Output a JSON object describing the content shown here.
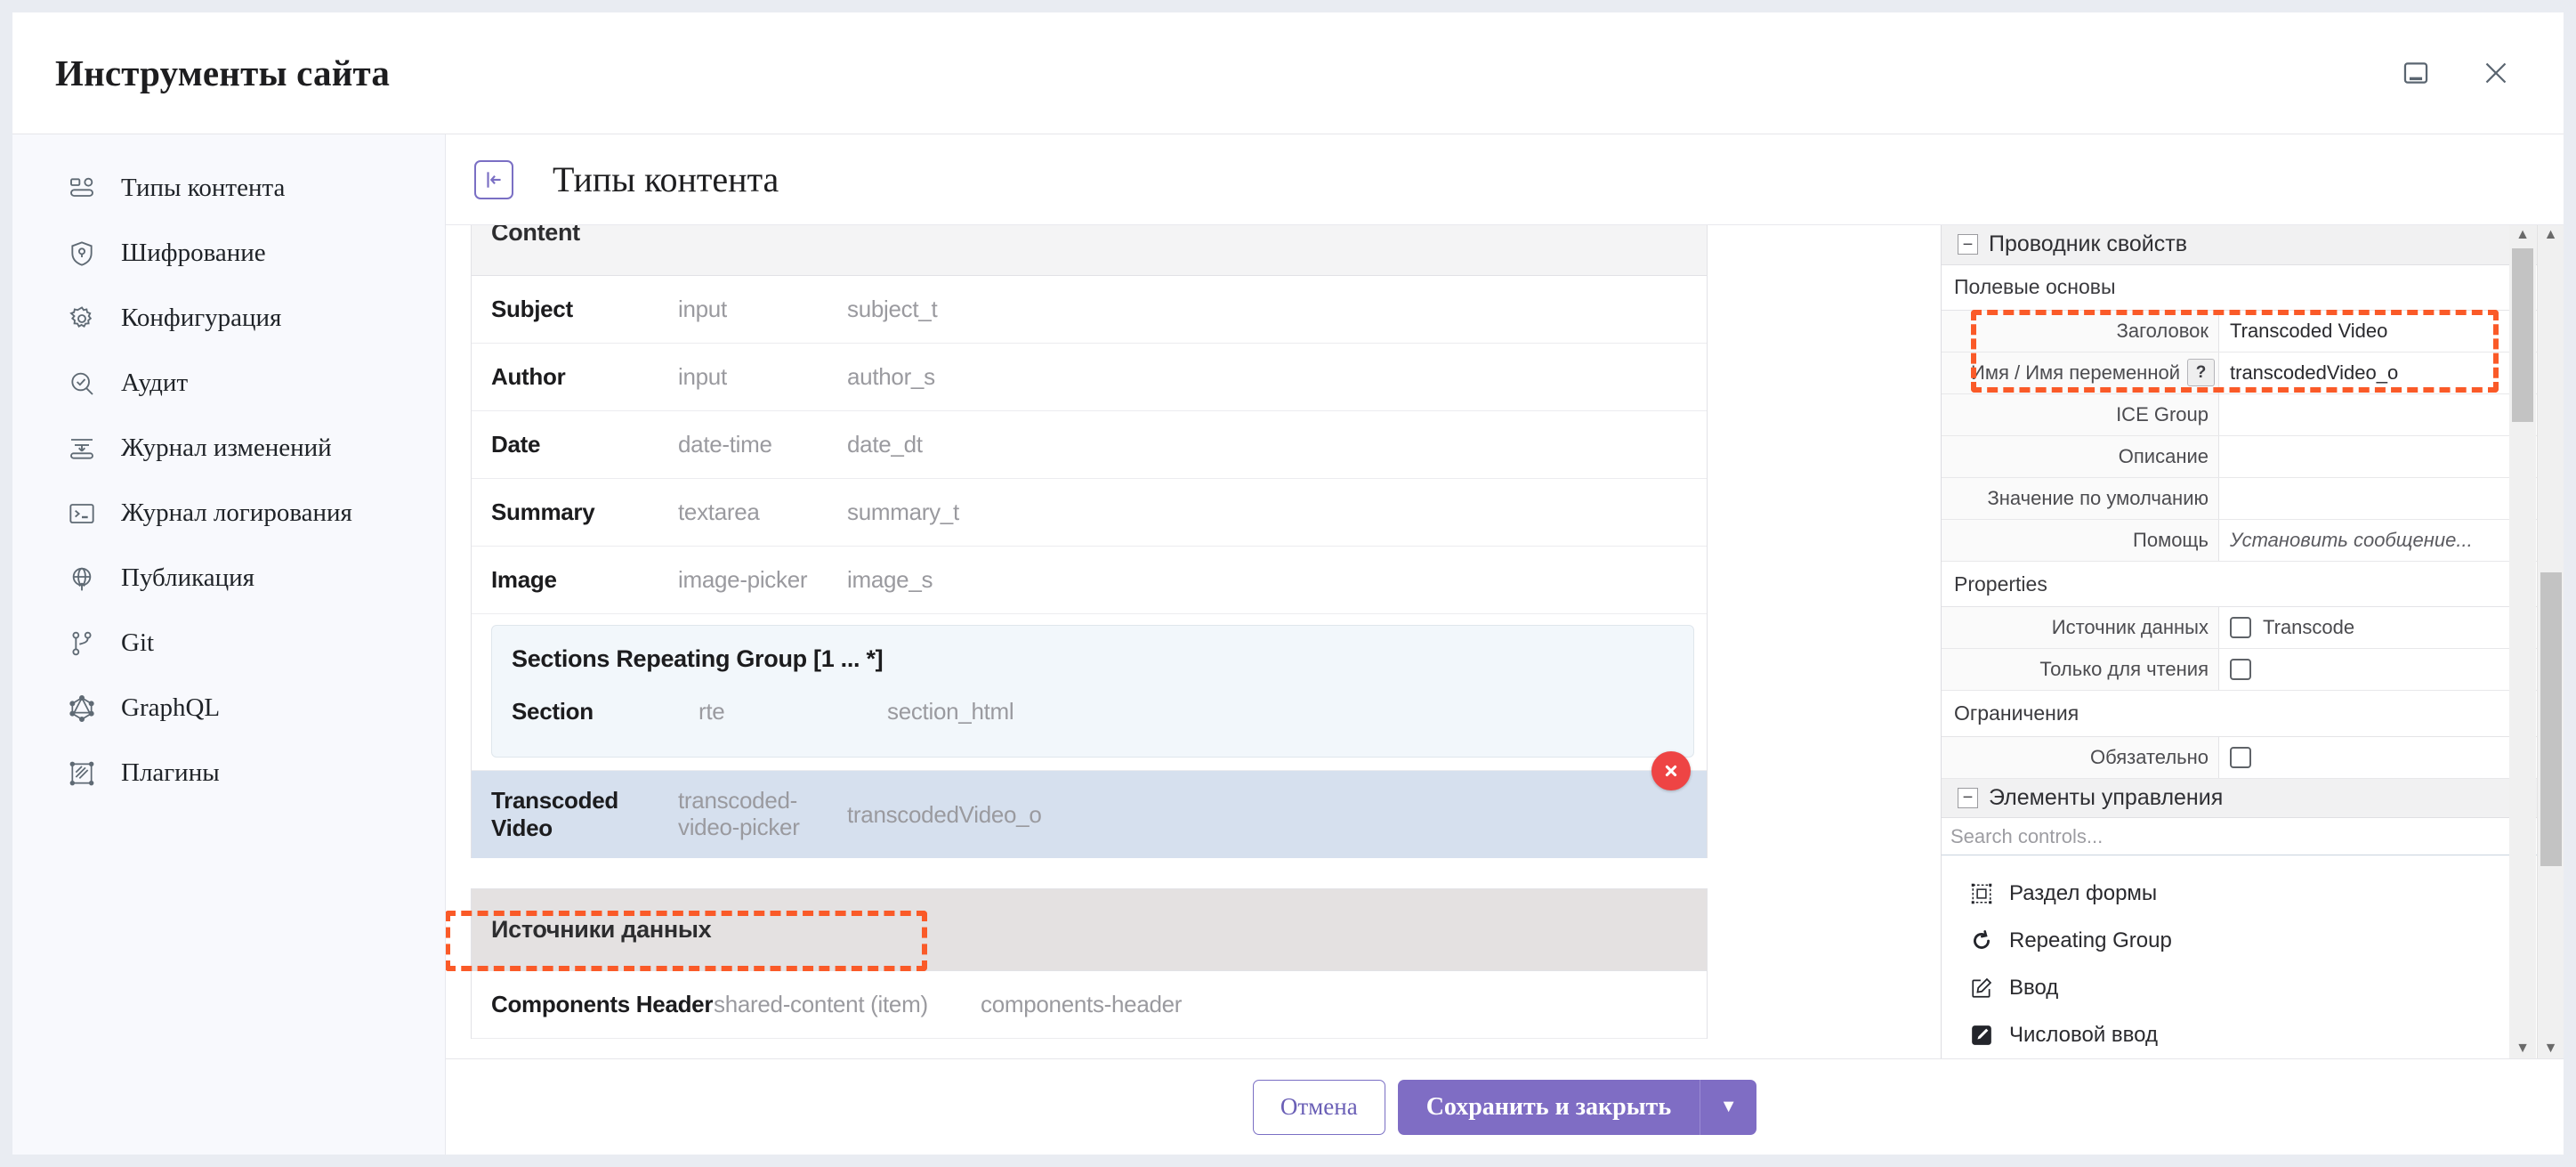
{
  "window": {
    "title": "Инструменты сайта",
    "restore_icon": "restore-window-icon",
    "close_icon": "close-icon"
  },
  "sidebar": {
    "items": [
      {
        "label": "Типы контента",
        "icon": "content-types-icon"
      },
      {
        "label": "Шифрование",
        "icon": "shield-lock-icon"
      },
      {
        "label": "Конфигурация",
        "icon": "gear-icon"
      },
      {
        "label": "Аудит",
        "icon": "audit-search-icon"
      },
      {
        "label": "Журнал изменений",
        "icon": "changelog-icon"
      },
      {
        "label": "Журнал логирования",
        "icon": "terminal-icon"
      },
      {
        "label": "Публикация",
        "icon": "globe-publish-icon"
      },
      {
        "label": "Git",
        "icon": "git-branch-icon"
      },
      {
        "label": "GraphQL",
        "icon": "graphql-icon"
      },
      {
        "label": "Плагины",
        "icon": "plugins-icon"
      }
    ]
  },
  "main": {
    "collapse_icon": "collapse-panel-icon",
    "title": "Типы контента",
    "content_group": {
      "header": "Content",
      "rows": [
        {
          "name": "Subject",
          "type": "input",
          "id": "subject_t"
        },
        {
          "name": "Author",
          "type": "input",
          "id": "author_s"
        },
        {
          "name": "Date",
          "type": "date-time",
          "id": "date_dt"
        },
        {
          "name": "Summary",
          "type": "textarea",
          "id": "summary_t"
        },
        {
          "name": "Image",
          "type": "image-picker",
          "id": "image_s"
        }
      ],
      "repeating_group": {
        "title": "Sections Repeating Group [1 ... *]",
        "rows": [
          {
            "name": "Section",
            "type": "rte",
            "id": "section_html"
          }
        ]
      },
      "selected_row": {
        "name": "Transcoded Video",
        "type": "transcoded-video-picker",
        "id": "transcodedVideo_o",
        "delete_icon": "delete-field-icon"
      }
    },
    "datasources_group": {
      "header": "Источники данных",
      "rows": [
        {
          "name": "Components Header",
          "type": "shared-content (item)",
          "id": "components-header"
        }
      ]
    }
  },
  "properties_panel": {
    "header": {
      "label": "Проводник свойств",
      "expander": "collapse-expander-icon"
    },
    "sections": [
      {
        "title": "Полевые основы",
        "rows": [
          {
            "label": "Заголовок",
            "value": "Transcoded Video",
            "kind": "text"
          },
          {
            "label": "Имя / Имя переменной",
            "value": "transcodedVideo_o",
            "kind": "text",
            "help": "?"
          },
          {
            "label": "ICE Group",
            "value": "",
            "kind": "text"
          },
          {
            "label": "Описание",
            "value": "",
            "kind": "text"
          },
          {
            "label": "Значение по умолчанию",
            "value": "",
            "kind": "text"
          },
          {
            "label": "Помощь",
            "value": "Установить сообщение...",
            "kind": "placeholder"
          }
        ]
      },
      {
        "title": "Properties",
        "rows": [
          {
            "label": "Источник данных",
            "value": "Transcode",
            "kind": "checkbox",
            "checked": false
          },
          {
            "label": "Только для чтения",
            "value": "",
            "kind": "checkbox",
            "checked": false
          }
        ]
      },
      {
        "title": "Ограничения",
        "rows": [
          {
            "label": "Обязательно",
            "value": "",
            "kind": "checkbox",
            "checked": false
          }
        ]
      }
    ],
    "controls": {
      "header": {
        "label": "Элементы управления",
        "expander": "collapse-expander-icon"
      },
      "search_placeholder": "Search controls...",
      "items": [
        {
          "label": "Раздел формы",
          "icon": "form-section-icon"
        },
        {
          "label": "Repeating Group",
          "icon": "repeating-group-icon"
        },
        {
          "label": "Ввод",
          "icon": "input-pencil-icon"
        },
        {
          "label": "Числовой ввод",
          "icon": "numeric-input-icon"
        }
      ]
    }
  },
  "footer": {
    "cancel_label": "Отмена",
    "save_label": "Сохранить и закрыть",
    "dropdown_icon": "chevron-down-icon"
  },
  "colors": {
    "accent_purple": "#7f6dc4",
    "highlight_orange": "#fa5a28",
    "selected_row_bg": "#d6e0ee",
    "delete_red": "#ee4444"
  }
}
